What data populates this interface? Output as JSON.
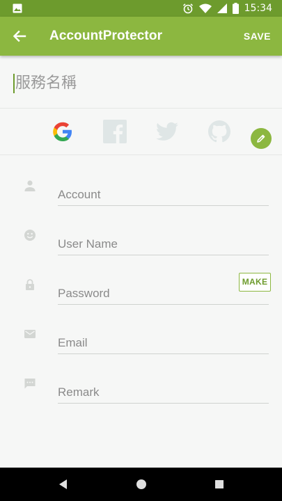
{
  "status_bar": {
    "time": "15:34",
    "icons": [
      "image-icon",
      "alarm-icon",
      "wifi-icon",
      "signal-icon",
      "battery-icon"
    ]
  },
  "app_bar": {
    "title": "AccountProtector",
    "save_label": "SAVE",
    "back_icon": "arrow-back-icon"
  },
  "service": {
    "name_placeholder": "服務名稱",
    "edit_icon": "pencil-icon"
  },
  "social": [
    {
      "name": "google-icon"
    },
    {
      "name": "facebook-icon"
    },
    {
      "name": "twitter-icon"
    },
    {
      "name": "github-icon"
    }
  ],
  "form": {
    "account": {
      "label": "Account",
      "icon": "person-icon"
    },
    "username": {
      "label": "User Name",
      "icon": "face-icon"
    },
    "password": {
      "label": "Password",
      "icon": "lock-icon",
      "make_label": "MAKE"
    },
    "email": {
      "label": "Email",
      "icon": "mail-icon"
    },
    "remark": {
      "label": "Remark",
      "icon": "comment-icon"
    }
  },
  "colors": {
    "primary": "#8cb740",
    "primary_dark": "#6d9b2d",
    "background": "#f6f7f6"
  },
  "nav_bar": {
    "icons": [
      "back-triangle-icon",
      "home-circle-icon",
      "recents-square-icon"
    ]
  }
}
